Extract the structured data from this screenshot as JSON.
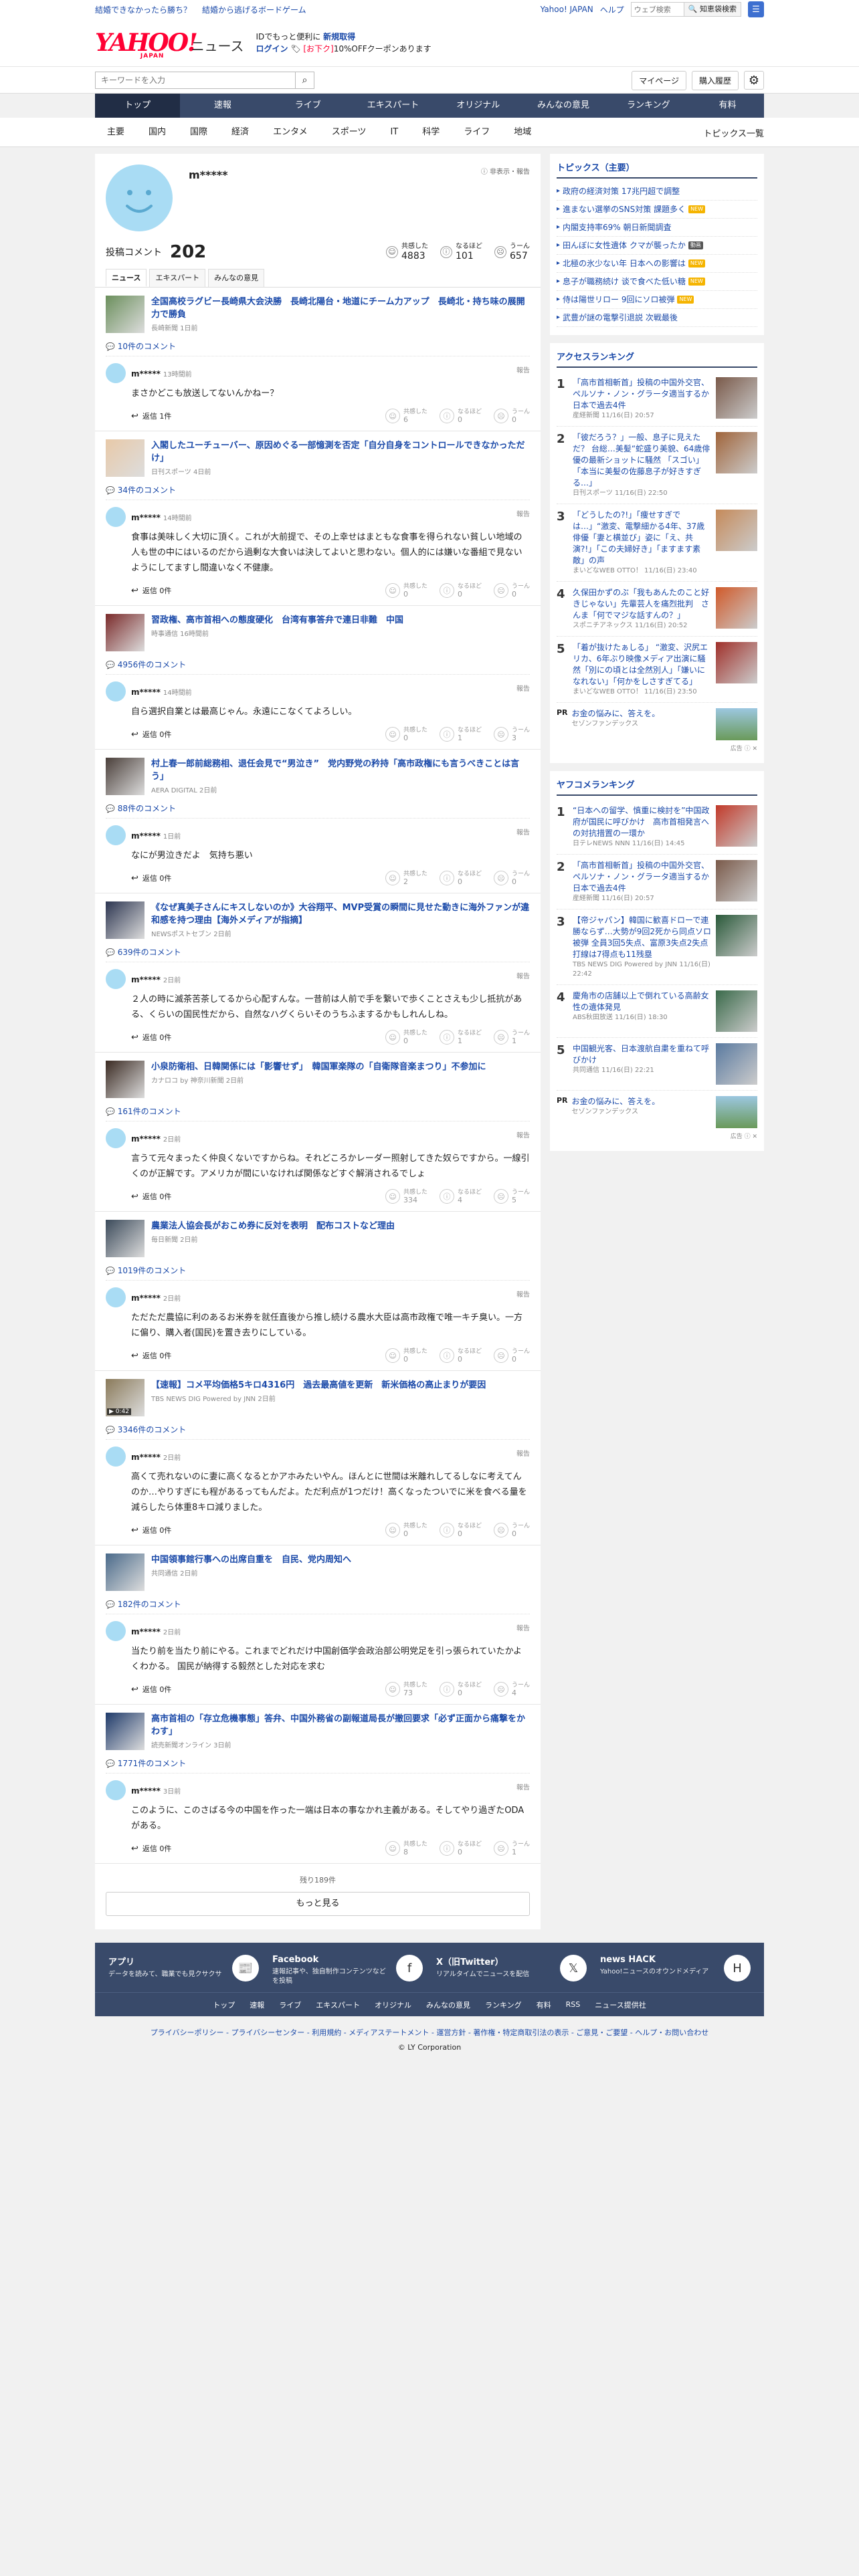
{
  "promo": {
    "left1": "結婚できなかったら勝ち？",
    "left2": "結婚から逃げるボードゲーム",
    "yahoo_japan": "Yahoo! JAPAN",
    "help": "ヘルプ",
    "search_placeholder": "ウェブ検索",
    "search_btn": "🔍 知恵袋検索"
  },
  "header": {
    "logo": "YAHOO!",
    "logo_sub": "JAPAN",
    "service": "ニュース",
    "promo1": "IDでもっと便利に",
    "promo1_b": "新規取得",
    "promo2": "ログイン",
    "promo2_tag": "[お下ク]",
    "promo2_txt": "10%OFFクーポンあります"
  },
  "search": {
    "placeholder": "キーワードを入力",
    "mypage": "マイページ",
    "history": "購入履歴"
  },
  "gnav": [
    "トップ",
    "速報",
    "ライブ",
    "エキスパート",
    "オリジナル",
    "みんなの意見",
    "ランキング",
    "有料"
  ],
  "cnav": [
    "主要",
    "国内",
    "国際",
    "経済",
    "エンタメ",
    "スポーツ",
    "IT",
    "科学",
    "ライフ",
    "地域"
  ],
  "cnav_right": "トピックス一覧",
  "profile": {
    "name": "m*****",
    "report": "ⓘ 非表示・報告",
    "label": "投稿コメント",
    "count": "202",
    "reacts": [
      {
        "icon": "☺",
        "label": "共感した",
        "value": "4883"
      },
      {
        "icon": "ⓘ",
        "label": "なるほど",
        "value": "101"
      },
      {
        "icon": "☹",
        "label": "うーん",
        "value": "657"
      }
    ],
    "tabs": [
      "ニュース",
      "エキスパート",
      "みんなの意見"
    ]
  },
  "react_labels": [
    "共感した",
    "なるほど",
    "うーん"
  ],
  "comments": [
    {
      "title": "全国高校ラグビー長崎県大会決勝　長崎北陽台・地道にチーム力アップ　長崎北・持ち味の展開力で勝負",
      "source": "長崎新聞 1日前",
      "count": "10件のコメント",
      "user": "m*****",
      "time": "13時間前",
      "body": "まさかどこも放送してないんかねー？",
      "reply": "返信 1件",
      "r": [
        "6",
        "0",
        "0"
      ],
      "thumb": "#6b8f5c"
    },
    {
      "title": "入閣したユーチューバー、原因めぐる一部憶測を否定「自分自身をコントロールできなかっただけ」",
      "source": "日刊スポーツ 4日前",
      "count": "34件のコメント",
      "user": "m*****",
      "time": "14時間前",
      "body": "食事は美味しく大切に頂く。これが大前提で、その上幸せはまともな食事を得られない貧しい地域の人も世の中にはいるのだから過剰な大食いは決してよいと思わない。個人的には嫌いな番組で見ないようにしてますし間違いなく不健康。",
      "reply": "返信 0件",
      "r": [
        "0",
        "0",
        "0"
      ],
      "thumb": "#e8c9a8"
    },
    {
      "title": "習政権、高市首相への態度硬化　台湾有事答弁で連日非難　中国",
      "source": "時事通信 16時間前",
      "count": "4956件のコメント",
      "user": "m*****",
      "time": "14時間前",
      "body": "自ら選択自業とは最高じゃん。永遠にこなくてよろしい。",
      "reply": "返信 0件",
      "r": [
        "0",
        "1",
        "3"
      ],
      "thumb": "#7a2a2a"
    },
    {
      "title": "村上春一郎前総務相、退任会見で“男泣き”　党内野党の矜持「高市政権にも言うべきことは言う」",
      "source": "AERA DIGITAL 2日前",
      "count": "88件のコメント",
      "user": "m*****",
      "time": "1日前",
      "body": "なにが男泣きだよ　気持ち悪い",
      "reply": "返信 0件",
      "r": [
        "2",
        "0",
        "0"
      ],
      "thumb": "#4a3f3a"
    },
    {
      "title": "《なぜ真美子さんにキスしないのか》大谷翔平、MVP受賞の瞬間に見せた動きに海外ファンが違和感を持つ理由【海外メディアが指摘】",
      "source": "NEWSポストセブン 2日前",
      "count": "639件のコメント",
      "user": "m*****",
      "time": "2日前",
      "body": "２人の時に滅茶苦茶してるから心配すんな。一昔前は人前で手を繋いで歩くことさえも少し抵抗がある、くらいの国民性だから、自然なハグくらいそのうちふまするかもしれんしね。",
      "reply": "返信 0件",
      "r": [
        "0",
        "1",
        "1"
      ],
      "thumb": "#2c3550"
    },
    {
      "title": "小泉防衛相、日韓関係には「影響せず」　韓国軍楽隊の「自衛隊音楽まつり」不参加に",
      "source": "カナロコ by 神奈川新聞 2日前",
      "count": "161件のコメント",
      "user": "m*****",
      "time": "2日前",
      "body": "言うて元々まったく仲良くないですからね。それどころかレーダー照射してきた奴らですから。一線引くのが正解です。アメリカが間にいなければ関係などすぐ解消されるでしょ",
      "reply": "返信 0件",
      "r": [
        "334",
        "4",
        "5"
      ],
      "thumb": "#3a2a22"
    },
    {
      "title": "農業法人協会長がおこめ券に反対を表明　配布コストなど理由",
      "source": "毎日新聞 2日前",
      "count": "1019件のコメント",
      "user": "m*****",
      "time": "2日前",
      "body": "ただただ農協に利のあるお米券を就任直後から推し続ける農水大臣は高市政権で唯一キチ臭い。一方に偏り、購入者(国民)を置き去りにしている。",
      "reply": "返信 0件",
      "r": [
        "0",
        "0",
        "0"
      ],
      "thumb": "#3b4a5a"
    },
    {
      "title": "【速報】コメ平均価格5キロ4316円　過去最高値を更新　新米価格の高止まりが要因",
      "source": "TBS NEWS DIG Powered by JNN 2日前",
      "count": "3346件のコメント",
      "user": "m*****",
      "time": "2日前",
      "body": "高くて売れないのに妻に高くなるとかアホみたいやん。ほんとに世間は米離れしてるしなに考えてんのか…やりすぎにも程があるってもんだよ。ただ利点が1つだけ！高くなったついでに米を食べる量を減らしたら体重8キロ減りました。",
      "reply": "返信 0件",
      "r": [
        "0",
        "0",
        "0"
      ],
      "thumb": "#8a7a5a",
      "duration": "▶ 0:42"
    },
    {
      "title": "中国領事館行事への出席自重を　自民、党内周知へ",
      "source": "共同通信 2日前",
      "count": "182件のコメント",
      "user": "m*****",
      "time": "2日前",
      "body": "当たり前を当たり前にやる。これまでどれだけ中国創価学会政治部公明党足を引っ張られていたかよくわかる。 国民が納得する毅然とした対応を求む",
      "reply": "返信 0件",
      "r": [
        "73",
        "0",
        "4"
      ],
      "thumb": "#4a6a8a"
    },
    {
      "title": "高市首相の「存立危機事態」答弁、中国外務省の副報道局長が撤回要求「必ず正面から痛撃をかわす」",
      "source": "読売新聞オンライン 3日前",
      "count": "1771件のコメント",
      "user": "m*****",
      "time": "3日前",
      "body": "このように、このさばる今の中国を作った一端は日本の事なかれ主義がある。そしてやり過ぎたODAがある。",
      "reply": "返信 0件",
      "r": [
        "8",
        "0",
        "1"
      ],
      "thumb": "#1f3a6a"
    }
  ],
  "more": {
    "rest": "残り189件",
    "button": "もっと見る"
  },
  "topics": {
    "title": "トピックス（主要）",
    "items": [
      {
        "text": "政府の経済対策 17兆円超で調整",
        "badge": ""
      },
      {
        "text": "進まない選挙のSNS対策 課題多く",
        "badge": "NEW"
      },
      {
        "text": "内閣支持率69% 朝日新聞調査",
        "badge": ""
      },
      {
        "text": "田んぼに女性遺体 クマが襲ったか",
        "badge": "動画"
      },
      {
        "text": "北極の氷少ない年 日本への影響は",
        "badge": "NEW"
      },
      {
        "text": "息子が職務続け 谈で食べた低い糖",
        "badge": "NEW"
      },
      {
        "text": "侍は陽世リロー 9回にソロ被弾",
        "badge": "NEW"
      },
      {
        "text": "武豊が謎の電撃引退説 次戦最後",
        "badge": ""
      }
    ]
  },
  "access": {
    "title": "アクセスランキング",
    "items": [
      {
        "no": "1",
        "text": "「高市首相斬首」投稿の中国外交官、ペルソナ・ノン・グラータ適当するか　日本で過去4件",
        "meta": "産経新聞 11/16(日) 20:57",
        "color": "#7a5a4a"
      },
      {
        "no": "2",
        "text": "「彼だろう？」一般、息子に見えただ？ 台総…美髪“蛇盛り美貌、64歳俳優の最新ショットに騒然 「スゴい」「本当に美髪の佐藤息子が好きすぎる…」",
        "meta": "日刊スポーツ 11/16(日) 22:50",
        "color": "#a0643a"
      },
      {
        "no": "3",
        "text": "「どうしたの?!」「痩せすぎでは…」“激変、電撃細かる4年、37歳俳優「妻と横並び」姿に「え、共演?!」「この夫婦好き」「ますます素敵」の声",
        "meta": "まいどなWEB OTTO！ 11/16(日) 23:40",
        "color": "#c58a5a"
      },
      {
        "no": "4",
        "text": "久保田かずのぶ「我もあんたのこと好きじゃない」先輩芸人を痛烈批判　さんま「何でマジな話すんの？」",
        "meta": "スポニチアネックス 11/16(日) 20:52",
        "color": "#d05a2a"
      },
      {
        "no": "5",
        "text": "「着が抜けたぁしる」 “激変、沢尻エリカ、6年ぶり映像メディア出演に騒然「別にの頃とは全然別人」「嫌いになれない」「何かをしさすぎてる」",
        "meta": "まいどなWEB OTTO！ 11/16(日) 23:50",
        "color": "#a0302a"
      }
    ],
    "pr": {
      "k": "PR",
      "text": "お金の悩みに、答えを。",
      "meta": "セゾンファンデックス",
      "ad": "広告 ⓘ ✕"
    }
  },
  "yahoo_rank": {
    "title": "ヤフコメランキング",
    "items": [
      {
        "no": "1",
        "text": "“日本への留学、慎重に検討を”中国政府が国民に呼びかけ　高市首相発言への対抗措置の一環か",
        "meta": "日テレNEWS NNN 11/16(日) 14:45",
        "color": "#c23a2a"
      },
      {
        "no": "2",
        "text": "「高市首相斬首」投稿の中国外交官、ペルソナ・ノン・グラータ適当するか　日本で過去4件",
        "meta": "産経新聞 11/16(日) 20:57",
        "color": "#7a5a4a"
      },
      {
        "no": "3",
        "text": "【帝ジャパン】韓国に歓喜ドローで連勝ならず…大勢が9回2死から同点ソロ被弾 全員3回5失点、富原3失点2失点 打線は7得点も11残塁",
        "meta": "TBS NEWS DIG Powered by JNN 11/16(日) 22:42",
        "color": "#2a5a3a"
      },
      {
        "no": "4",
        "text": "慶角市の店舗以上で倒れている高齢女性の遺体発見",
        "meta": "ABS秋田放送 11/16(日) 18:30",
        "color": "#3a6a4a"
      },
      {
        "no": "5",
        "text": "中国観光客、日本渡航自粛を重ねて呼びかけ",
        "meta": "共同通信 11/16(日) 22:21",
        "color": "#5a7aa0"
      }
    ],
    "pr": {
      "k": "PR",
      "text": "お金の悩みに、答えを。",
      "meta": "セゾンファンデックス",
      "ad": "広告 ⓘ ✕"
    }
  },
  "apps": [
    {
      "title": "アプリ",
      "desc": "データを読みて、職業でも見クサクサ",
      "icon": "📰"
    },
    {
      "title": "Facebook",
      "desc": "速報記事や、独自制作コンテンツなどを投稿",
      "icon": "f"
    },
    {
      "title": "X（旧Twitter）",
      "desc": "リアルタイムでニュースを配信",
      "icon": "𝕏"
    },
    {
      "title": "news HACK",
      "desc": "Yahoo!ニュースのオウンドメディア",
      "icon": "H"
    }
  ],
  "footer_links": [
    "トップ",
    "速報",
    "ライブ",
    "エキスパート",
    "オリジナル",
    "みんなの意見",
    "ランキング",
    "有料",
    "RSS",
    "ニュース提供社"
  ],
  "legal": "プライバシーポリシー - プライバシーセンター - 利用規約 - メディアステートメント - 運営方針 - 著作権・特定商取引法の表示 - ご意見・ご要望 - ヘルプ・お問い合わせ",
  "copyright": "© LY Corporation"
}
